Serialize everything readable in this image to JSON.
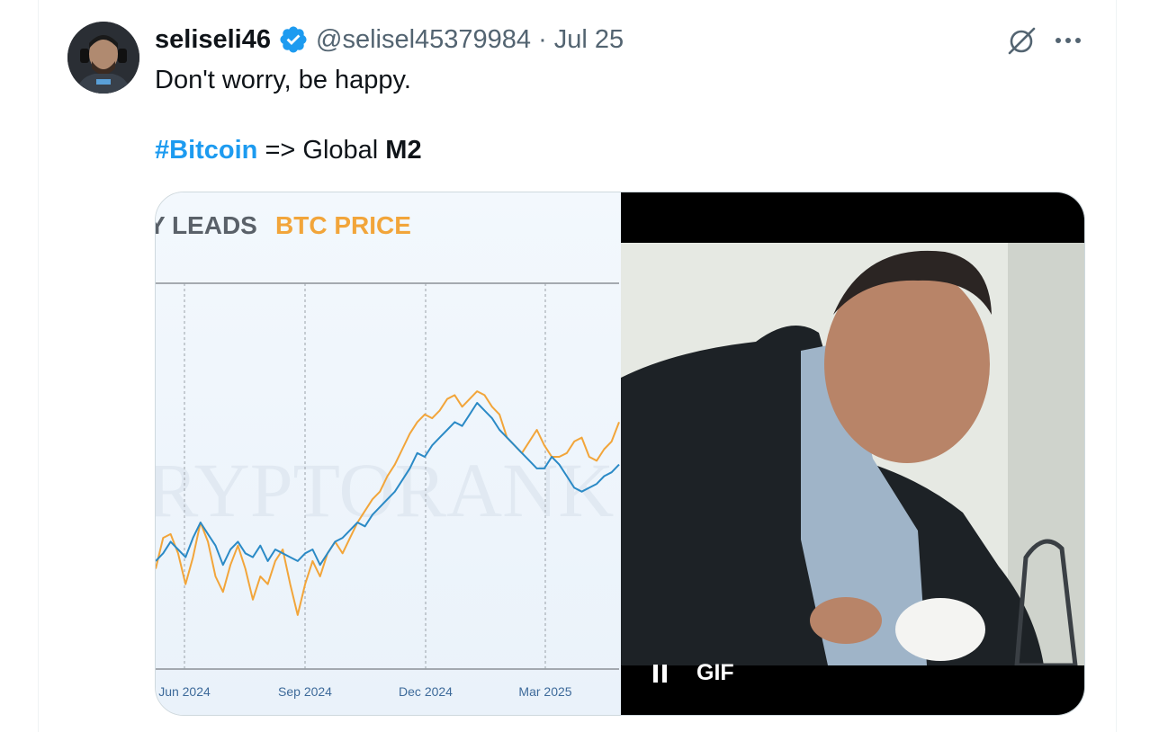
{
  "tweet": {
    "display_name": "seliseli46",
    "handle": "@selisel45379984",
    "separator": "·",
    "date": "Jul 25",
    "text_line1": "Don't worry, be happy.",
    "hashtag": "#Bitcoin",
    "text_middle": " => Global ",
    "text_bold": "M2"
  },
  "icons": {
    "verified": "verified-badge-icon",
    "grok": "grok-icon",
    "more": "more-icon",
    "pause": "pause-icon"
  },
  "media": {
    "gif_label": "GIF"
  },
  "chart_data": {
    "type": "line",
    "title_part1": "Y LEADS ",
    "title_part2": "BTC PRICE",
    "watermark": "RYPTORANK",
    "x_ticks": [
      "Jun 2024",
      "Sep 2024",
      "Dec 2024",
      "Mar 2025"
    ],
    "ylim": [
      0,
      100
    ],
    "series": [
      {
        "color": "#2b8ac6",
        "values": [
          28,
          30,
          33,
          31,
          29,
          34,
          38,
          35,
          32,
          27,
          31,
          33,
          30,
          29,
          32,
          28,
          31,
          30,
          29,
          28,
          30,
          31,
          27,
          30,
          33,
          34,
          36,
          38,
          37,
          40,
          42,
          44,
          46,
          49,
          52,
          56,
          55,
          58,
          60,
          62,
          64,
          63,
          66,
          69,
          67,
          65,
          62,
          60,
          58,
          56,
          54,
          52,
          52,
          55,
          53,
          50,
          47,
          46,
          47,
          48,
          50,
          51,
          53
        ]
      },
      {
        "color": "#f2a53a",
        "values": [
          26,
          34,
          35,
          30,
          22,
          29,
          38,
          33,
          24,
          20,
          27,
          32,
          26,
          18,
          24,
          22,
          28,
          31,
          22,
          14,
          22,
          28,
          24,
          30,
          33,
          30,
          34,
          38,
          41,
          44,
          46,
          50,
          53,
          57,
          61,
          64,
          66,
          65,
          67,
          70,
          71,
          68,
          70,
          72,
          71,
          68,
          66,
          60,
          58,
          56,
          59,
          62,
          58,
          55,
          55,
          56,
          59,
          60,
          55,
          54,
          57,
          59,
          64
        ]
      }
    ]
  }
}
